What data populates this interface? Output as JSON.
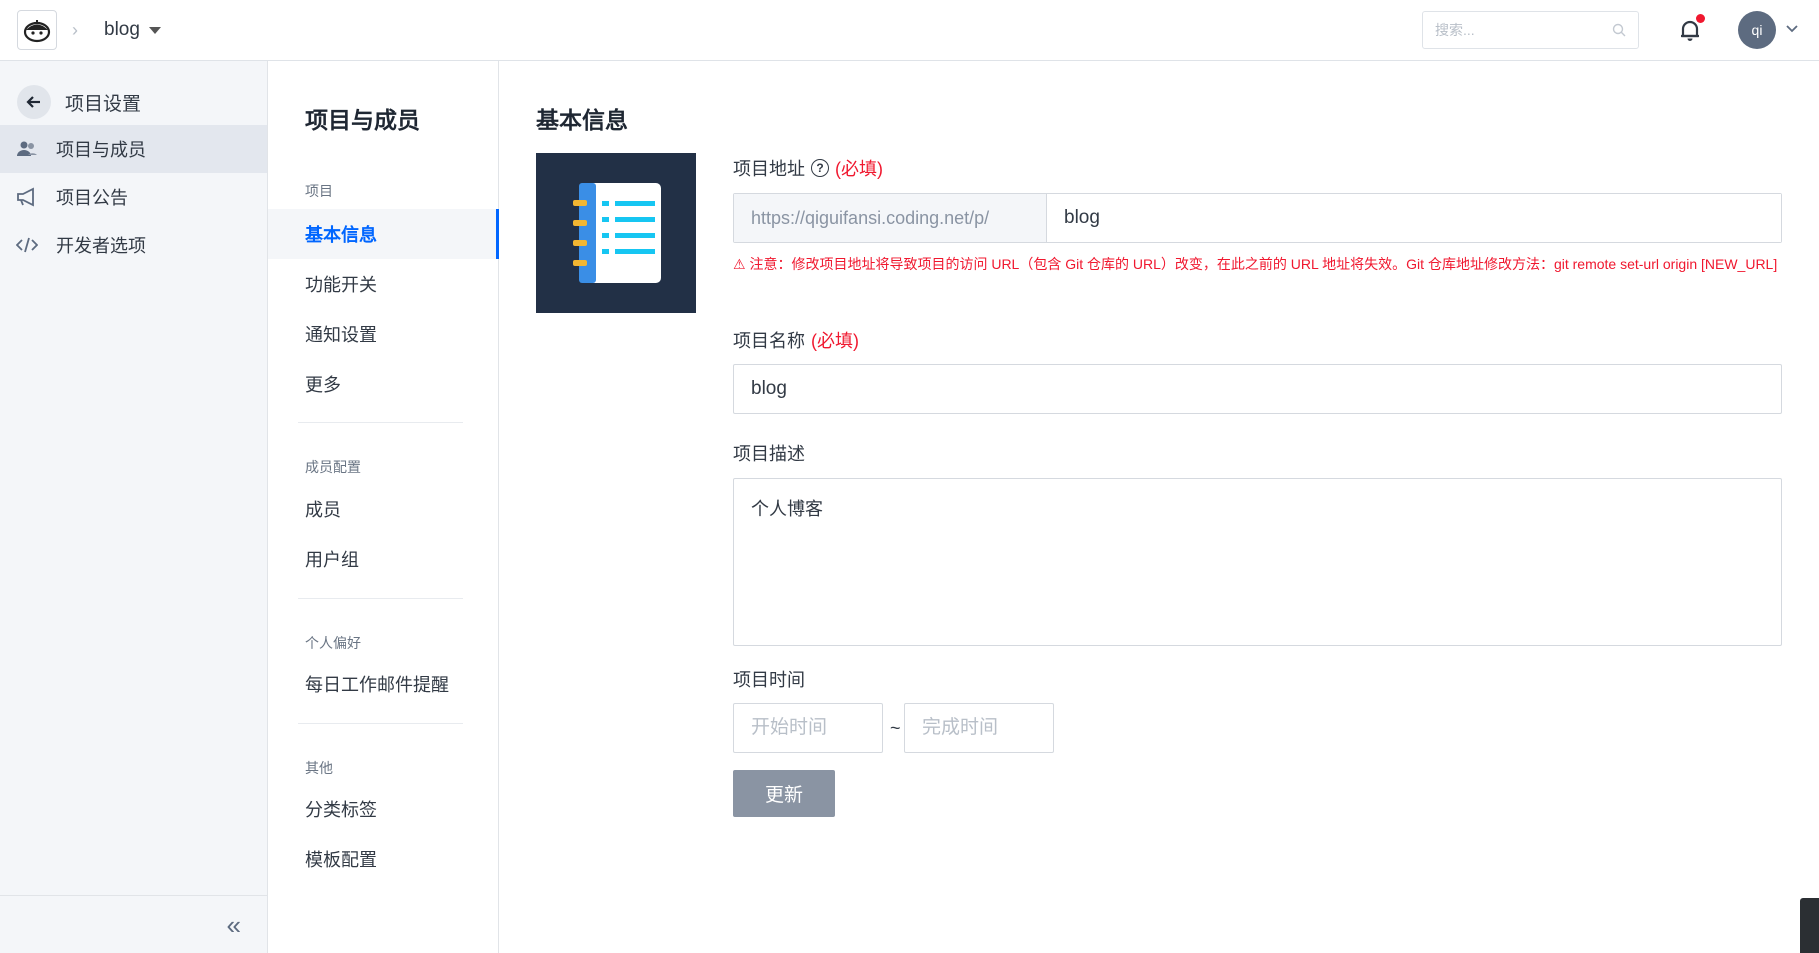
{
  "topbar": {
    "project_name": "blog",
    "search_placeholder": "搜索...",
    "avatar_text": "qi"
  },
  "sidebar": {
    "title": "项目设置",
    "items": [
      {
        "label": "项目与成员",
        "icon": "members-icon",
        "active": true
      },
      {
        "label": "项目公告",
        "icon": "megaphone-icon",
        "active": false
      },
      {
        "label": "开发者选项",
        "icon": "code-icon",
        "active": false
      }
    ],
    "collapse_glyph": "«"
  },
  "midnav": {
    "title": "项目与成员",
    "groups": [
      {
        "label": "项目",
        "items": [
          "基本信息",
          "功能开关",
          "通知设置",
          "更多"
        ]
      },
      {
        "label": "成员配置",
        "items": [
          "成员",
          "用户组"
        ]
      },
      {
        "label": "个人偏好",
        "items": [
          "每日工作邮件提醒"
        ]
      },
      {
        "label": "其他",
        "items": [
          "分类标签",
          "模板配置"
        ]
      }
    ],
    "active_item": "基本信息"
  },
  "main": {
    "title": "基本信息",
    "address": {
      "label": "项目地址",
      "help": "?",
      "required": "(必填)",
      "prefix": "https://qiguifansi.coding.net/p/",
      "value": "blog",
      "warning": "⚠ 注意：修改项目地址将导致项目的访问 URL（包含 Git 仓库的 URL）改变，在此之前的 URL 地址将失效。Git 仓库地址修改方法：git remote set-url origin [NEW_URL]"
    },
    "name": {
      "label": "项目名称",
      "required": "(必填)",
      "value": "blog"
    },
    "description": {
      "label": "项目描述",
      "value": "个人博客"
    },
    "time": {
      "label": "项目时间",
      "start_placeholder": "开始时间",
      "end_placeholder": "完成时间",
      "separator": "~"
    },
    "update_button": "更新"
  },
  "colors": {
    "accent": "#0066ff",
    "required": "#f0182f",
    "icon_bg": "#223046",
    "button_disabled": "#8a94a3"
  }
}
